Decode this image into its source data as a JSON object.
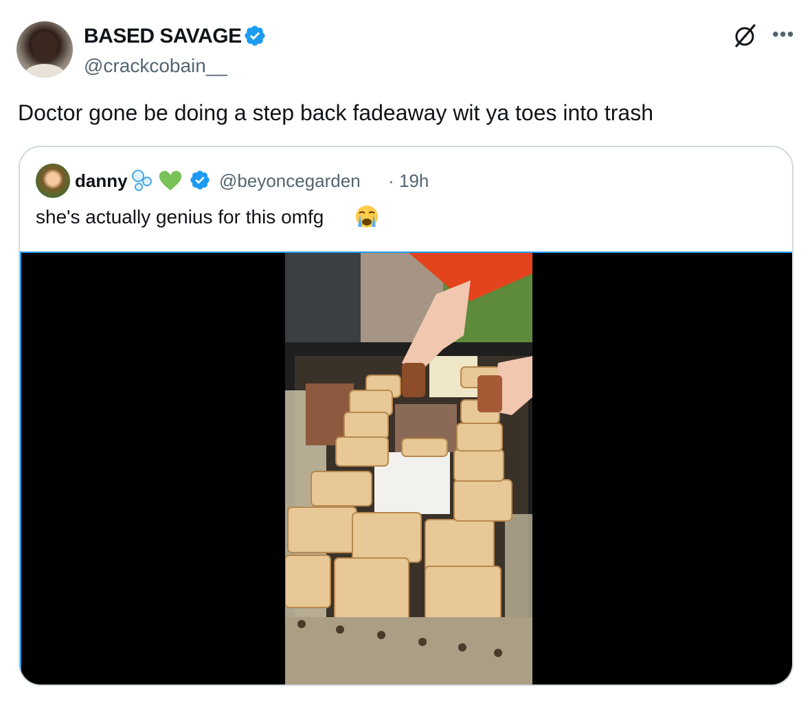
{
  "tweet": {
    "author": {
      "display_name": "BASED SAVAGE",
      "handle": "@crackcobain__",
      "verified": true
    },
    "text": "Doctor gone be doing a step back fadeaway wit ya toes into trash",
    "icons": {
      "grok": "grok-icon",
      "more": "more-icon"
    }
  },
  "quote": {
    "author": {
      "display_name": "danny",
      "handle": "@beyoncegarden",
      "verified": true,
      "emojis": [
        "bubbles-emoji",
        "green-heart-emoji"
      ]
    },
    "separator": "·",
    "time": "19h",
    "text": "she's actually genius for this omfg",
    "text_emoji": "sob-emoji",
    "media": {
      "type": "video"
    }
  },
  "colors": {
    "verified_blue": "#1d9bf0",
    "secondary_text": "#536471",
    "border": "#cfd9de"
  }
}
